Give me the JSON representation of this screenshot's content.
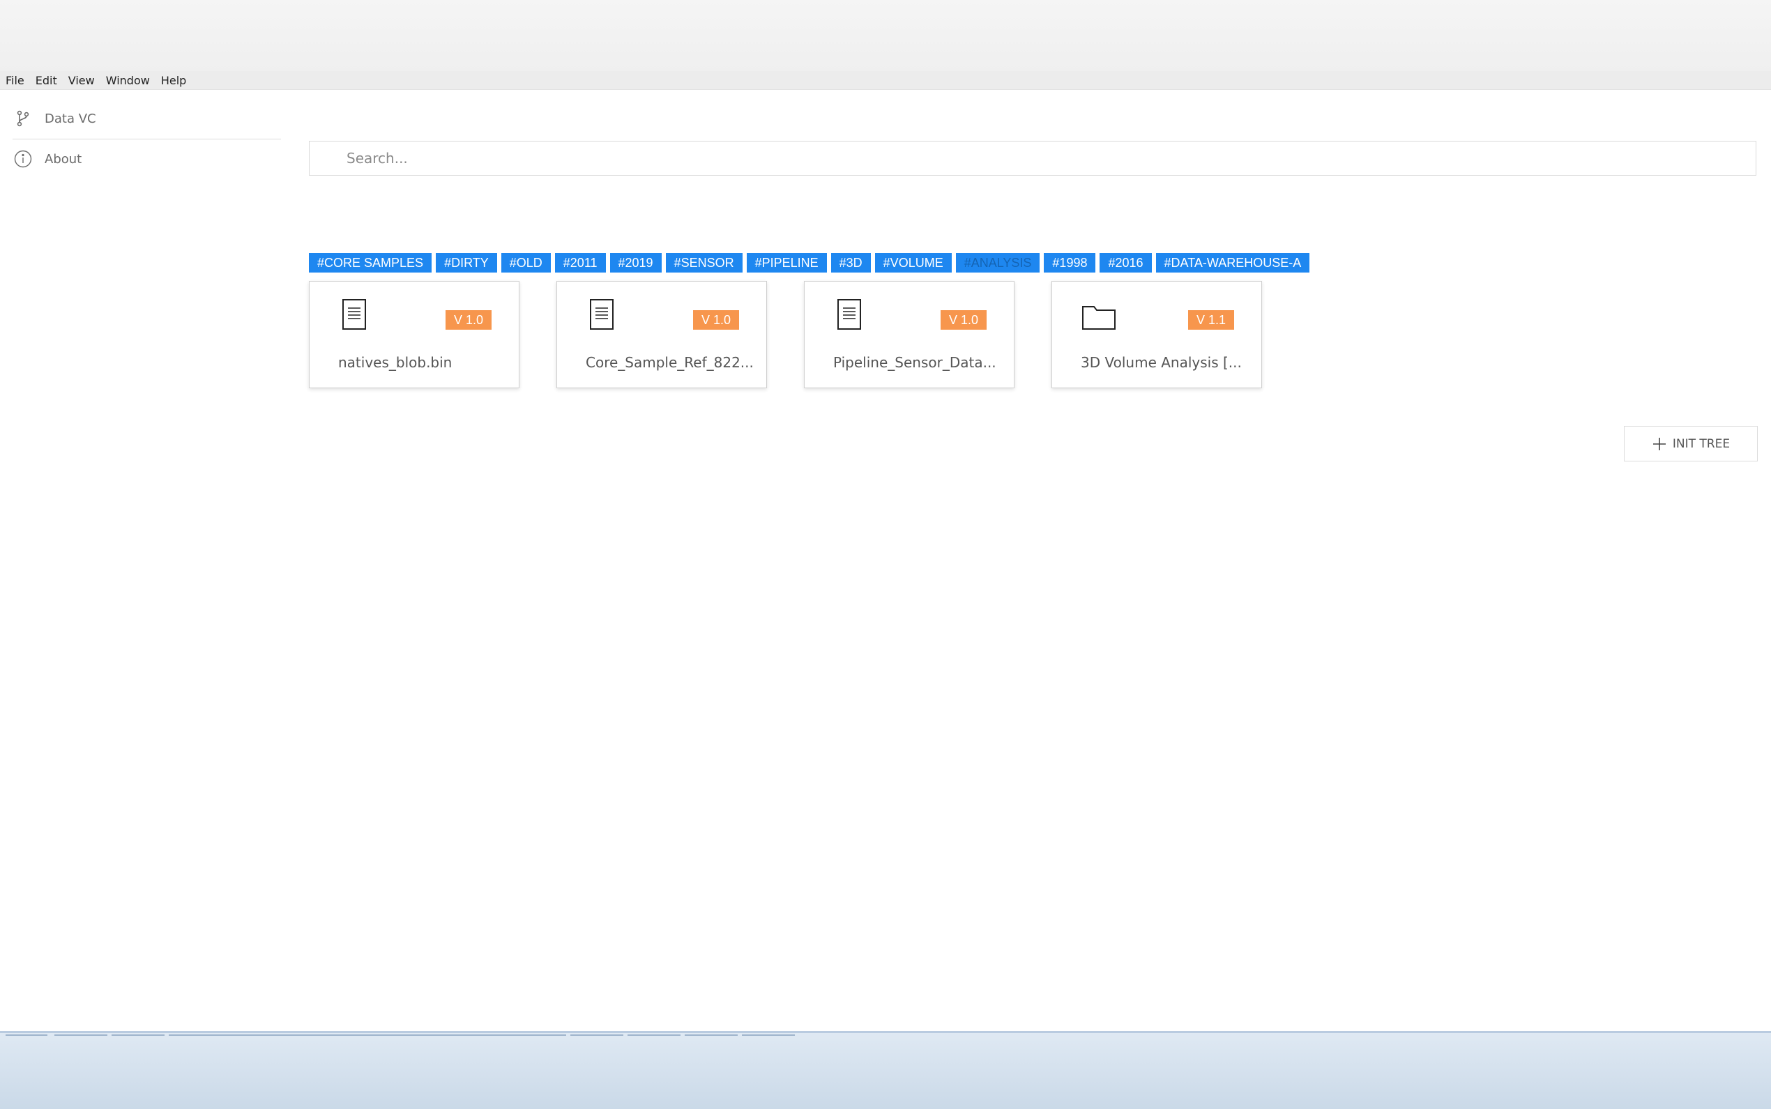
{
  "menu": [
    "File",
    "Edit",
    "View",
    "Window",
    "Help"
  ],
  "sidebar": {
    "items": [
      {
        "label": "Data VC",
        "icon": "branch-icon"
      },
      {
        "label": "About",
        "icon": "info-icon"
      }
    ]
  },
  "search": {
    "placeholder": "Search...",
    "value": ""
  },
  "tags": [
    "#CORE SAMPLES",
    "#DIRTY",
    "#OLD",
    "#2011",
    "#2019",
    "#SENSOR",
    "#PIPELINE",
    "#3D",
    "#VOLUME",
    "#ANALYSIS",
    "#1998",
    "#2016",
    "#DATA-WAREHOUSE-A"
  ],
  "active_tag": "#ANALYSIS",
  "cards": [
    {
      "name": "natives_blob.bin",
      "version": "V 1.0",
      "icon": "document-icon"
    },
    {
      "name": "Core_Sample_Ref_822...",
      "version": "V 1.0",
      "icon": "document-icon"
    },
    {
      "name": "Pipeline_Sensor_Data...",
      "version": "V 1.0",
      "icon": "document-icon"
    },
    {
      "name": "3D Volume Analysis [...",
      "version": "V 1.1",
      "icon": "folder-icon"
    }
  ],
  "init_button": {
    "label": "INIT TREE",
    "icon": "plus-icon"
  },
  "colors": {
    "tag_bg": "#1e87f0",
    "badge_bg": "#f7964d"
  }
}
